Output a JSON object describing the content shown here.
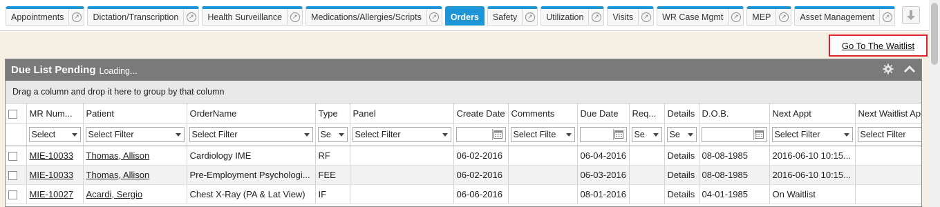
{
  "tabs": [
    {
      "label": "Appointments",
      "launch": true
    },
    {
      "label": "Dictation/Transcription",
      "launch": true
    },
    {
      "label": "Health Surveillance",
      "launch": true
    },
    {
      "label": "Medications/Allergies/Scripts",
      "launch": true
    },
    {
      "label": "Orders",
      "launch": false,
      "active": true
    },
    {
      "label": "Safety",
      "launch": true
    },
    {
      "label": "Utilization",
      "launch": true
    },
    {
      "label": "Visits",
      "launch": true
    },
    {
      "label": "WR Case Mgmt",
      "launch": true
    },
    {
      "label": "MEP",
      "launch": true
    },
    {
      "label": "Asset Management",
      "launch": true
    }
  ],
  "waitlist_link": "Go To The Waitlist",
  "panel": {
    "title": "Due List Pending",
    "status": "Loading...",
    "group_hint": "Drag a column and drop it here to group by that column"
  },
  "columns": [
    "MR Num...",
    "Patient",
    "OrderName",
    "Type",
    "Panel",
    "Create Date",
    "Comments",
    "Due Date",
    "Req...",
    "Details",
    "D.O.B.",
    "Next Appt",
    "Next Waitlist Appt"
  ],
  "filters": {
    "mr": "Select",
    "patient": "Select Filter",
    "order": "Select Filter",
    "type": "Se",
    "panel": "Select Filter",
    "comments": "Select Filte",
    "req": "Se",
    "details": "Se",
    "next_appt": "Select Filter",
    "next_waitlist": "Select Filter"
  },
  "rows": [
    {
      "mr": "MIE-10033",
      "patient": "Thomas, Allison",
      "order": "Cardiology IME",
      "type": "RF",
      "panel": "",
      "create": "06-02-2016",
      "comments": "",
      "due": "06-04-2016",
      "req": "",
      "details": "Details",
      "dob": "08-08-1985",
      "next_appt": "2016-06-10 10:15...",
      "next_waitlist": ""
    },
    {
      "mr": "MIE-10033",
      "patient": "Thomas, Allison",
      "order": "Pre-Employment Psychologi...",
      "type": "FEE",
      "panel": "",
      "create": "06-02-2016",
      "comments": "",
      "due": "06-03-2016",
      "req": "",
      "details": "Details",
      "dob": "08-08-1985",
      "next_appt": "2016-06-10 10:15...",
      "next_waitlist": ""
    },
    {
      "mr": "MIE-10027",
      "patient": "Acardi, Sergio",
      "order": "Chest X-Ray (PA & Lat View)",
      "type": "IF",
      "panel": "",
      "create": "06-06-2016",
      "comments": "",
      "due": "08-01-2016",
      "req": "",
      "details": "Details",
      "dob": "04-01-1985",
      "next_appt": "On Waitlist",
      "next_waitlist": ""
    }
  ]
}
